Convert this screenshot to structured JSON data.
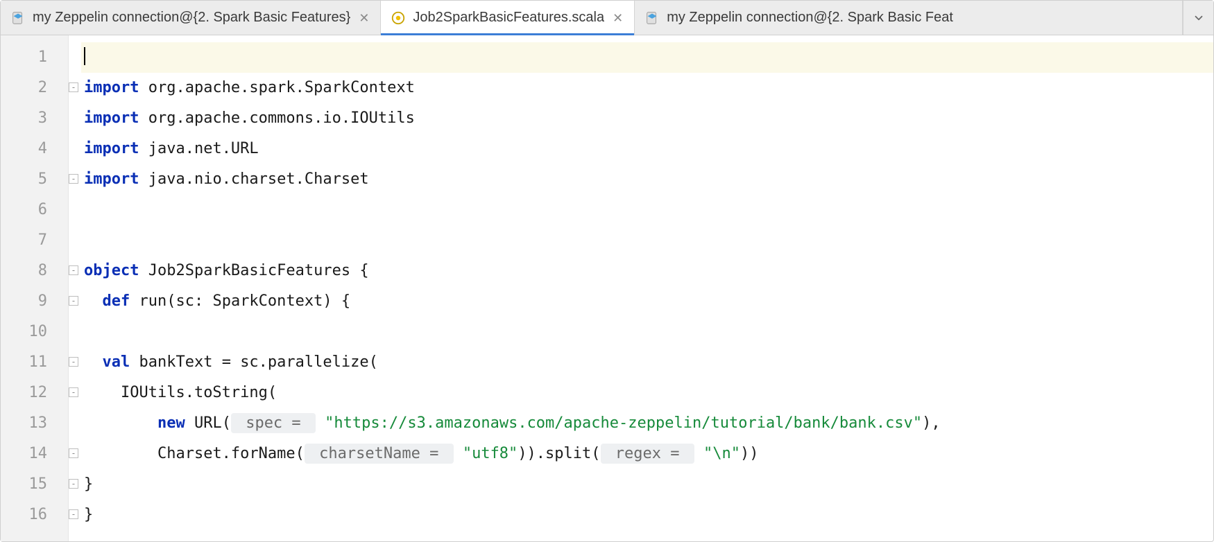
{
  "tabs": [
    {
      "label": "my Zeppelin connection@{2. Spark Basic Features}",
      "icon": "zeppelin"
    },
    {
      "label": "Job2SparkBasicFeatures.scala",
      "icon": "scala",
      "active": true
    },
    {
      "label": "my Zeppelin connection@{2. Spark Basic Feat",
      "icon": "zeppelin"
    }
  ],
  "status_icon": "check-ok",
  "gutter": {
    "start": 1,
    "end": 16
  },
  "code": {
    "l1": "",
    "l2": {
      "kw": "import",
      "rest": " org.apache.spark.SparkContext"
    },
    "l3": {
      "kw": "import",
      "rest": " org.apache.commons.io.IOUtils"
    },
    "l4": {
      "kw": "import",
      "rest": " java.net.URL"
    },
    "l5": {
      "kw": "import",
      "rest": " java.nio.charset.Charset"
    },
    "l6": "",
    "l7": "",
    "l8": {
      "kw": "object",
      "name": " Job2SparkBasicFeatures ",
      "brace": "{"
    },
    "l9": {
      "indent": "  ",
      "kw": "def",
      "sig": " run(sc: SparkContext) ",
      "brace": "{"
    },
    "l10": "",
    "l11": {
      "indent": "  ",
      "kw": "val",
      "rest": " bankText = sc.parallelize("
    },
    "l12": {
      "indent": "    ",
      "text": "IOUtils.toString("
    },
    "l13": {
      "indent": "        ",
      "kw": "new",
      "cls": " URL(",
      "hint": " spec = ",
      "str": "\"https://s3.amazonaws.com/apache-zeppelin/tutorial/bank/bank.csv\"",
      "tail": "),"
    },
    "l14": {
      "indent": "        ",
      "pre": "Charset.forName(",
      "hint1": " charsetName = ",
      "str1": "\"utf8\"",
      "mid": ")).split(",
      "hint2": " regex = ",
      "str2": "\"\\n\"",
      "tail": "))"
    },
    "l15": {
      "indent": "",
      "brace": "}"
    },
    "l16": {
      "indent": "",
      "brace": "}"
    }
  }
}
